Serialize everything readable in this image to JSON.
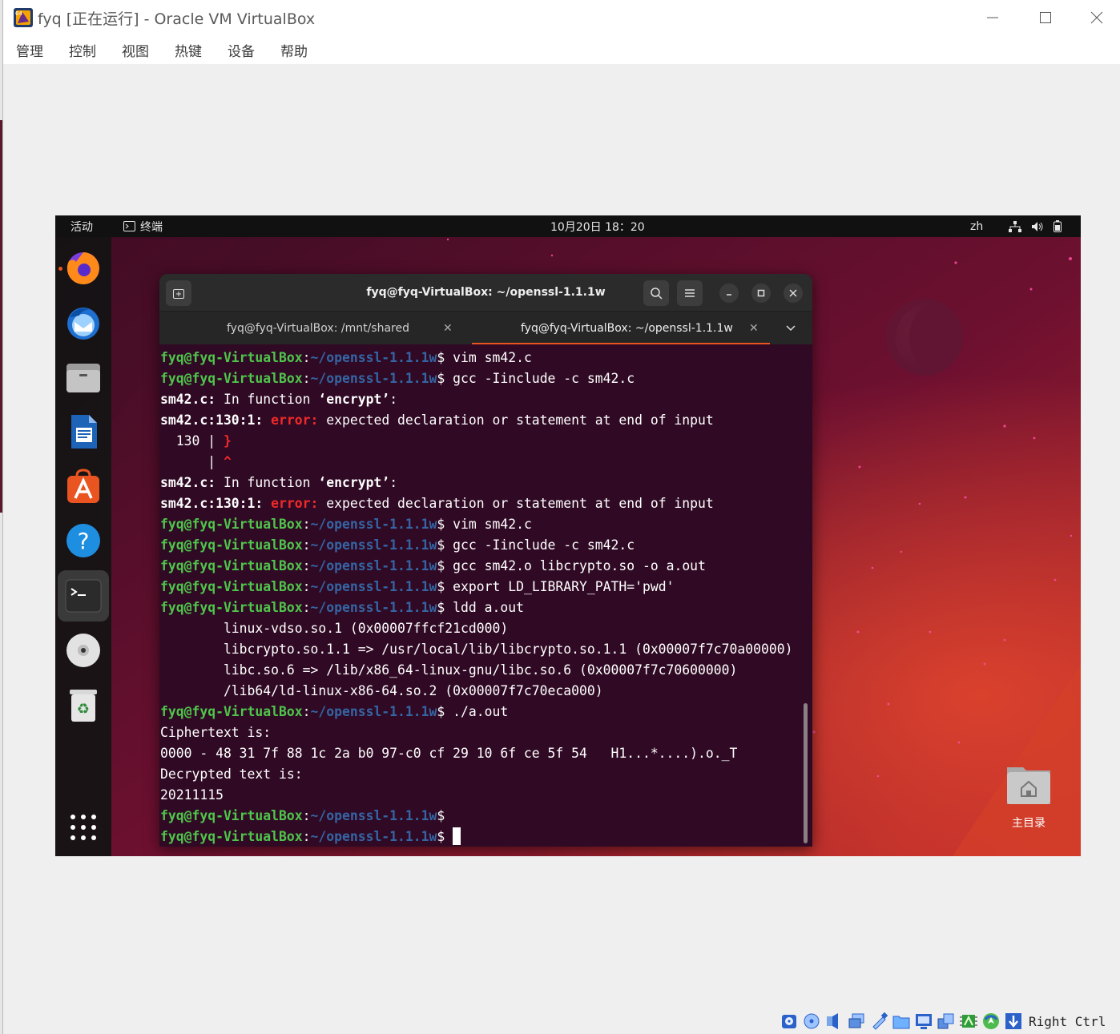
{
  "window": {
    "title": "fyq [正在运行] - Oracle VM VirtualBox"
  },
  "menubar": {
    "items": [
      "管理",
      "控制",
      "视图",
      "热键",
      "设备",
      "帮助"
    ]
  },
  "guest_topbar": {
    "activities": "活动",
    "app_name": "终端",
    "clock": "10月20日  18：20",
    "input_method": "zh"
  },
  "dock": {
    "items": [
      {
        "name": "firefox-icon"
      },
      {
        "name": "thunderbird-icon"
      },
      {
        "name": "files-icon"
      },
      {
        "name": "libreoffice-writer-icon"
      },
      {
        "name": "app-center-icon"
      },
      {
        "name": "help-icon"
      },
      {
        "name": "terminal-icon"
      },
      {
        "name": "cd-drive-icon"
      },
      {
        "name": "trash-icon"
      },
      {
        "name": "show-apps-icon"
      }
    ]
  },
  "terminal": {
    "title": "fyq@fyq-VirtualBox: ~/openssl-1.1.1w",
    "tabs": [
      {
        "label": "fyq@fyq-VirtualBox: /mnt/shared",
        "active": false
      },
      {
        "label": "fyq@fyq-VirtualBox: ~/openssl-1.1.1w",
        "active": true
      }
    ],
    "prompt_user": "fyq@fyq-VirtualBox",
    "prompt_path": "~/openssl-1.1.1w",
    "lines": [
      {
        "kind": "cmd",
        "text": "vim sm42.c"
      },
      {
        "kind": "cmd",
        "text": "gcc -Iinclude -c sm42.c"
      },
      {
        "kind": "info",
        "file": "sm42.c:",
        "msg": " In function ",
        "fn": "‘encrypt’",
        "end": ":"
      },
      {
        "kind": "err",
        "loc": "sm42.c:130:1:",
        "tag": " error:",
        "msg": " expected declaration or statement at end of input"
      },
      {
        "kind": "src",
        "lineno": "  130 | ",
        "code": "}"
      },
      {
        "kind": "src",
        "lineno": "      | ",
        "code": "^"
      },
      {
        "kind": "info",
        "file": "sm42.c:",
        "msg": " In function ",
        "fn": "‘encrypt’",
        "end": ":"
      },
      {
        "kind": "err",
        "loc": "sm42.c:130:1:",
        "tag": " error:",
        "msg": " expected declaration or statement at end of input"
      },
      {
        "kind": "cmd",
        "text": "vim sm42.c"
      },
      {
        "kind": "cmd",
        "text": "gcc -Iinclude -c sm42.c"
      },
      {
        "kind": "cmd",
        "text": "gcc sm42.o libcrypto.so -o a.out"
      },
      {
        "kind": "cmd",
        "text": "export LD_LIBRARY_PATH='pwd'"
      },
      {
        "kind": "cmd",
        "text": "ldd a.out"
      },
      {
        "kind": "out",
        "text": "        linux-vdso.so.1 (0x00007ffcf21cd000)"
      },
      {
        "kind": "out",
        "text": "        libcrypto.so.1.1 => /usr/local/lib/libcrypto.so.1.1 (0x00007f7c70a00000)"
      },
      {
        "kind": "out",
        "text": "        libc.so.6 => /lib/x86_64-linux-gnu/libc.so.6 (0x00007f7c70600000)"
      },
      {
        "kind": "out",
        "text": "        /lib64/ld-linux-x86-64.so.2 (0x00007f7c70eca000)"
      },
      {
        "kind": "cmd",
        "text": "./a.out"
      },
      {
        "kind": "out",
        "text": "Ciphertext is:"
      },
      {
        "kind": "out",
        "text": "0000 - 48 31 7f 88 1c 2a b0 97-c0 cf 29 10 6f ce 5f 54   H1...*....).o._T"
      },
      {
        "kind": "out",
        "text": "Decrypted text is:"
      },
      {
        "kind": "out",
        "text": "20211115"
      },
      {
        "kind": "cmd",
        "text": ""
      },
      {
        "kind": "cmd_cursor",
        "text": ""
      }
    ]
  },
  "desktop": {
    "home_folder_label": "主目录"
  },
  "statusbar": {
    "host_key": "Right Ctrl",
    "icons": [
      "hard-disk-icon",
      "optical-drive-icon",
      "audio-icon",
      "network-icon",
      "usb-icon",
      "shared-folders-icon",
      "display-icon",
      "recording-icon",
      "cpu-icon",
      "mouse-integration-icon",
      "keyboard-capture-icon"
    ]
  },
  "colors": {
    "terminal_bg": "#300a24",
    "prompt_user": "#4ec54b",
    "prompt_path": "#3465a4",
    "error": "#ef2929",
    "ubuntu_orange": "#e95420"
  }
}
